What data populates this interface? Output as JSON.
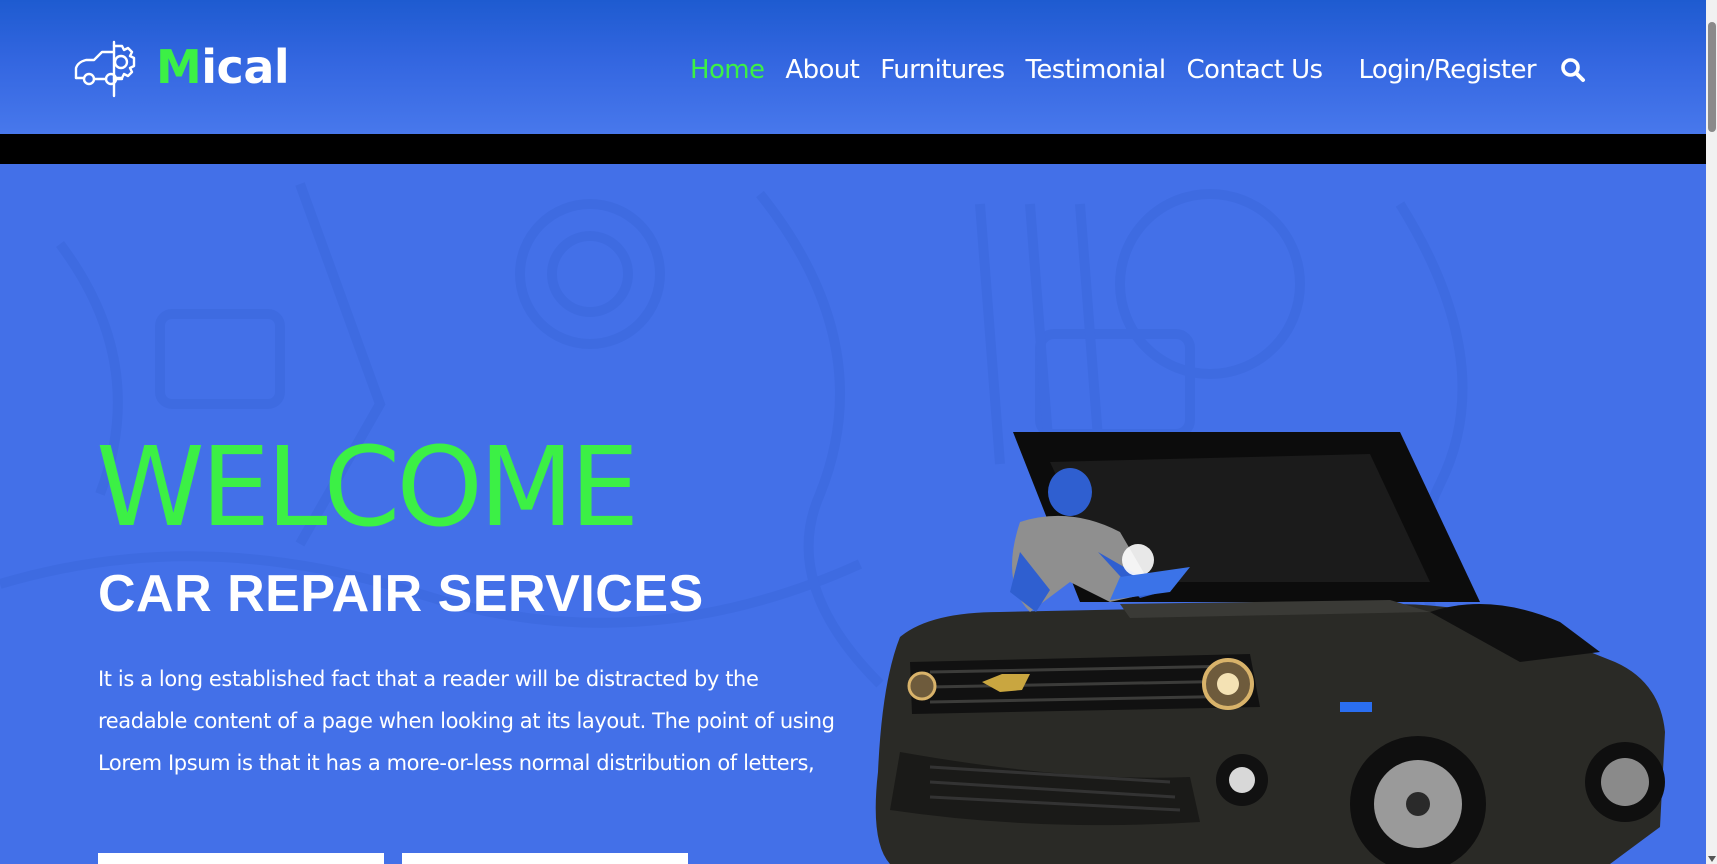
{
  "brand": {
    "name_first": "M",
    "name_rest": "ical",
    "accent": "#3cf045",
    "header_blue": "#2a5fd8",
    "hero_blue": "#4370e8"
  },
  "logo": {
    "icon": "car-gear-icon"
  },
  "nav": {
    "items": [
      {
        "label": "Home",
        "active": true
      },
      {
        "label": "About",
        "active": false
      },
      {
        "label": "Furnitures",
        "active": false
      },
      {
        "label": "Testimonial",
        "active": false
      },
      {
        "label": "Contact Us",
        "active": false
      }
    ],
    "login_label": "Login/Register",
    "search_icon": "search-icon"
  },
  "hero": {
    "heading": "WELCOME",
    "subheading": "CAR REPAIR SERVICES",
    "description": "It is a long established fact that a reader will be distracted by the readable content of a page when looking at its layout. The point of using Lorem Ipsum is that it has a more-or-less normal distribution of letters,",
    "image": "mechanic-repairing-car-image"
  }
}
